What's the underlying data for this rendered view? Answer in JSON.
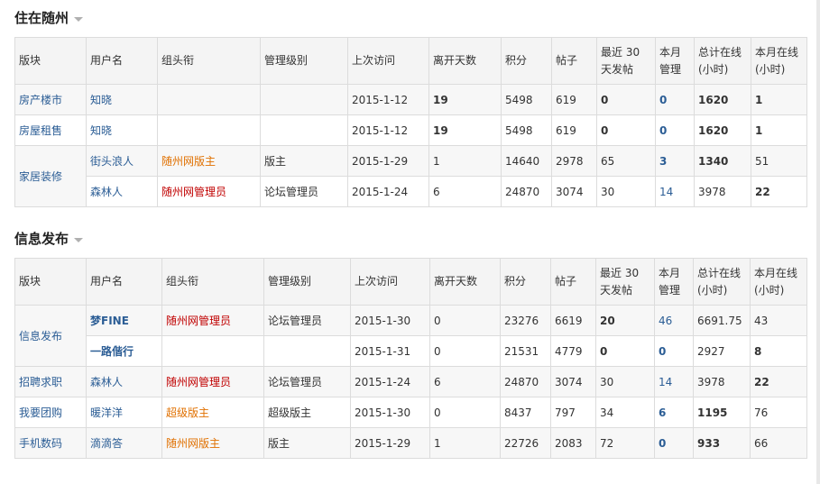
{
  "colors": {
    "link": "#2b5d95",
    "red_title": "#c00000",
    "orange_title": "#e07000",
    "header_bg": "#f4f4f4"
  },
  "headers": [
    "版块",
    "用户名",
    "组头衔",
    "管理级别",
    "上次访问",
    "离开天数",
    "积分",
    "帖子",
    "最近 30 天发帖",
    "本月管理",
    "总计在线(小时)",
    "本月在线(小时)"
  ],
  "sections": [
    {
      "title": "住在随州",
      "rows": [
        {
          "board": "房产楼市",
          "user": "知晓",
          "group": "",
          "level": "",
          "last": "2015-1-12",
          "days": "19",
          "points": "5498",
          "posts": "619",
          "recent": "0",
          "month_manage": "0",
          "total": "1620",
          "month_online": "1"
        },
        {
          "board": "房屋租售",
          "user": "知晓",
          "group": "",
          "level": "",
          "last": "2015-1-12",
          "days": "19",
          "points": "5498",
          "posts": "619",
          "recent": "0",
          "month_manage": "0",
          "total": "1620",
          "month_online": "1"
        },
        {
          "board": "家居装修",
          "user": "街头浪人",
          "group": "随州网版主",
          "level": "版主",
          "last": "2015-1-29",
          "days": "1",
          "points": "14640",
          "posts": "2978",
          "recent": "65",
          "month_manage": "3",
          "total": "1340",
          "month_online": "51"
        },
        {
          "board": "",
          "user": "森林人",
          "group": "随州网管理员",
          "level": "论坛管理员",
          "last": "2015-1-24",
          "days": "6",
          "points": "24870",
          "posts": "3074",
          "recent": "30",
          "month_manage": "14",
          "total": "3978",
          "month_online": "22"
        }
      ]
    },
    {
      "title": "信息发布",
      "rows": [
        {
          "board": "信息发布",
          "user": "梦FINE",
          "group": "随州网管理员",
          "level": "论坛管理员",
          "last": "2015-1-30",
          "days": "0",
          "points": "23276",
          "posts": "6619",
          "recent": "20",
          "month_manage": "46",
          "total": "6691.75",
          "month_online": "43"
        },
        {
          "board": "",
          "user": "一路偕行",
          "group": "",
          "level": "",
          "last": "2015-1-31",
          "days": "0",
          "points": "21531",
          "posts": "4779",
          "recent": "0",
          "month_manage": "0",
          "total": "2927",
          "month_online": "8"
        },
        {
          "board": "招聘求职",
          "user": "森林人",
          "group": "随州网管理员",
          "level": "论坛管理员",
          "last": "2015-1-24",
          "days": "6",
          "points": "24870",
          "posts": "3074",
          "recent": "30",
          "month_manage": "14",
          "total": "3978",
          "month_online": "22"
        },
        {
          "board": "我要团购",
          "user": "暖洋洋",
          "group": "超级版主",
          "level": "超级版主",
          "last": "2015-1-30",
          "days": "0",
          "points": "8437",
          "posts": "797",
          "recent": "34",
          "month_manage": "6",
          "total": "1195",
          "month_online": "76"
        },
        {
          "board": "手机数码",
          "user": "滴滴答",
          "group": "随州网版主",
          "level": "版主",
          "last": "2015-1-29",
          "days": "1",
          "points": "22726",
          "posts": "2083",
          "recent": "72",
          "month_manage": "0",
          "total": "933",
          "month_online": "66"
        }
      ]
    }
  ]
}
